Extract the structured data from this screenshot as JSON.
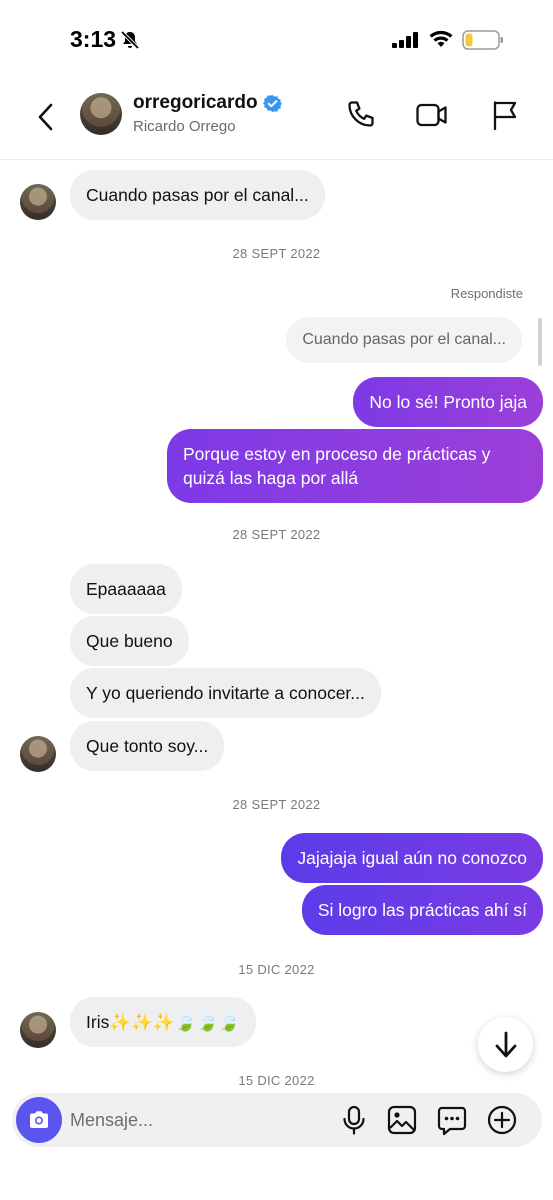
{
  "status": {
    "time": "3:13"
  },
  "header": {
    "username": "orregoricardo",
    "full_name": "Ricardo Orrego",
    "verified": true
  },
  "colors": {
    "accent": "#7b3fe4",
    "incoming_bubble": "#efeff2",
    "verified_blue": "#3897f0",
    "camera_button": "#5b55f0"
  },
  "messages": {
    "m1": "Cuando pasas por el canal...",
    "date1": "28 SEPT 2022",
    "replied_label": "Respondiste",
    "quote": "Cuando pasas por el canal...",
    "m2": "No lo sé! Pronto jaja",
    "m3_line1": "Porque estoy en proceso de prácticas y",
    "m3_line2": "quizá las haga por allá",
    "date2": "28 SEPT 2022",
    "m4": "Epaaaaaa",
    "m5": "Que bueno",
    "m6": "Y yo queriendo invitarte a conocer...",
    "m7": "Que tonto soy...",
    "date3": "28 SEPT 2022",
    "m8": "Jajajaja igual aún no conozco",
    "m9": "Si logro las prácticas ahí sí",
    "date4": "15 DIC 2022",
    "m10": "Iris✨✨✨🍃🍃🍃",
    "date5": "15 DIC 2022"
  },
  "composer": {
    "placeholder": "Mensaje..."
  },
  "icons": {
    "status": [
      "bell-off-icon",
      "signal-icon",
      "wifi-icon",
      "battery-icon"
    ],
    "header": [
      "back-icon",
      "phone-icon",
      "video-icon",
      "flag-icon"
    ],
    "composer": [
      "camera-icon",
      "microphone-icon",
      "image-icon",
      "sticker-icon",
      "plus-icon"
    ]
  }
}
